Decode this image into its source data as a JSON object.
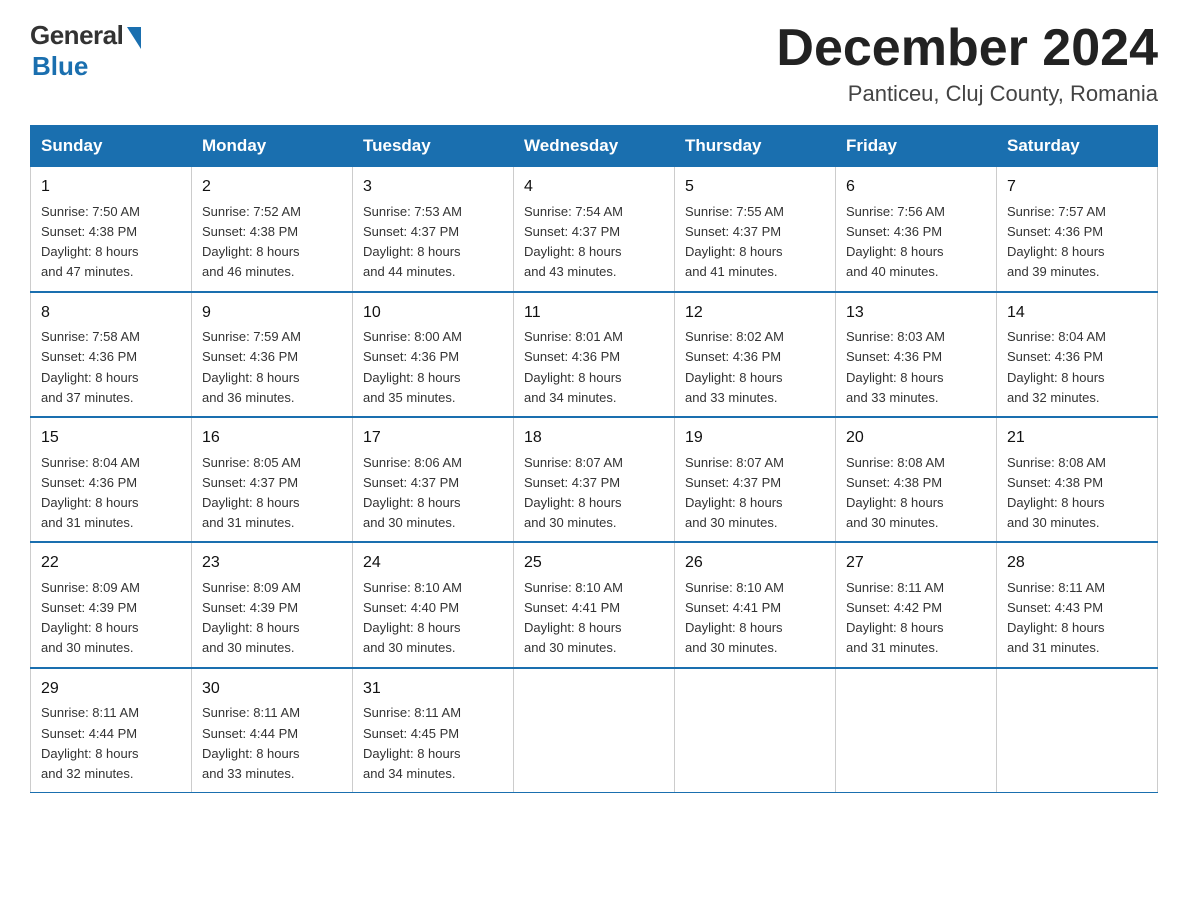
{
  "logo": {
    "general": "General",
    "blue": "Blue"
  },
  "title": "December 2024",
  "subtitle": "Panticeu, Cluj County, Romania",
  "weekdays": [
    "Sunday",
    "Monday",
    "Tuesday",
    "Wednesday",
    "Thursday",
    "Friday",
    "Saturday"
  ],
  "weeks": [
    [
      {
        "day": "1",
        "sunrise": "7:50 AM",
        "sunset": "4:38 PM",
        "daylight": "8 hours and 47 minutes."
      },
      {
        "day": "2",
        "sunrise": "7:52 AM",
        "sunset": "4:38 PM",
        "daylight": "8 hours and 46 minutes."
      },
      {
        "day": "3",
        "sunrise": "7:53 AM",
        "sunset": "4:37 PM",
        "daylight": "8 hours and 44 minutes."
      },
      {
        "day": "4",
        "sunrise": "7:54 AM",
        "sunset": "4:37 PM",
        "daylight": "8 hours and 43 minutes."
      },
      {
        "day": "5",
        "sunrise": "7:55 AM",
        "sunset": "4:37 PM",
        "daylight": "8 hours and 41 minutes."
      },
      {
        "day": "6",
        "sunrise": "7:56 AM",
        "sunset": "4:36 PM",
        "daylight": "8 hours and 40 minutes."
      },
      {
        "day": "7",
        "sunrise": "7:57 AM",
        "sunset": "4:36 PM",
        "daylight": "8 hours and 39 minutes."
      }
    ],
    [
      {
        "day": "8",
        "sunrise": "7:58 AM",
        "sunset": "4:36 PM",
        "daylight": "8 hours and 37 minutes."
      },
      {
        "day": "9",
        "sunrise": "7:59 AM",
        "sunset": "4:36 PM",
        "daylight": "8 hours and 36 minutes."
      },
      {
        "day": "10",
        "sunrise": "8:00 AM",
        "sunset": "4:36 PM",
        "daylight": "8 hours and 35 minutes."
      },
      {
        "day": "11",
        "sunrise": "8:01 AM",
        "sunset": "4:36 PM",
        "daylight": "8 hours and 34 minutes."
      },
      {
        "day": "12",
        "sunrise": "8:02 AM",
        "sunset": "4:36 PM",
        "daylight": "8 hours and 33 minutes."
      },
      {
        "day": "13",
        "sunrise": "8:03 AM",
        "sunset": "4:36 PM",
        "daylight": "8 hours and 33 minutes."
      },
      {
        "day": "14",
        "sunrise": "8:04 AM",
        "sunset": "4:36 PM",
        "daylight": "8 hours and 32 minutes."
      }
    ],
    [
      {
        "day": "15",
        "sunrise": "8:04 AM",
        "sunset": "4:36 PM",
        "daylight": "8 hours and 31 minutes."
      },
      {
        "day": "16",
        "sunrise": "8:05 AM",
        "sunset": "4:37 PM",
        "daylight": "8 hours and 31 minutes."
      },
      {
        "day": "17",
        "sunrise": "8:06 AM",
        "sunset": "4:37 PM",
        "daylight": "8 hours and 30 minutes."
      },
      {
        "day": "18",
        "sunrise": "8:07 AM",
        "sunset": "4:37 PM",
        "daylight": "8 hours and 30 minutes."
      },
      {
        "day": "19",
        "sunrise": "8:07 AM",
        "sunset": "4:37 PM",
        "daylight": "8 hours and 30 minutes."
      },
      {
        "day": "20",
        "sunrise": "8:08 AM",
        "sunset": "4:38 PM",
        "daylight": "8 hours and 30 minutes."
      },
      {
        "day": "21",
        "sunrise": "8:08 AM",
        "sunset": "4:38 PM",
        "daylight": "8 hours and 30 minutes."
      }
    ],
    [
      {
        "day": "22",
        "sunrise": "8:09 AM",
        "sunset": "4:39 PM",
        "daylight": "8 hours and 30 minutes."
      },
      {
        "day": "23",
        "sunrise": "8:09 AM",
        "sunset": "4:39 PM",
        "daylight": "8 hours and 30 minutes."
      },
      {
        "day": "24",
        "sunrise": "8:10 AM",
        "sunset": "4:40 PM",
        "daylight": "8 hours and 30 minutes."
      },
      {
        "day": "25",
        "sunrise": "8:10 AM",
        "sunset": "4:41 PM",
        "daylight": "8 hours and 30 minutes."
      },
      {
        "day": "26",
        "sunrise": "8:10 AM",
        "sunset": "4:41 PM",
        "daylight": "8 hours and 30 minutes."
      },
      {
        "day": "27",
        "sunrise": "8:11 AM",
        "sunset": "4:42 PM",
        "daylight": "8 hours and 31 minutes."
      },
      {
        "day": "28",
        "sunrise": "8:11 AM",
        "sunset": "4:43 PM",
        "daylight": "8 hours and 31 minutes."
      }
    ],
    [
      {
        "day": "29",
        "sunrise": "8:11 AM",
        "sunset": "4:44 PM",
        "daylight": "8 hours and 32 minutes."
      },
      {
        "day": "30",
        "sunrise": "8:11 AM",
        "sunset": "4:44 PM",
        "daylight": "8 hours and 33 minutes."
      },
      {
        "day": "31",
        "sunrise": "8:11 AM",
        "sunset": "4:45 PM",
        "daylight": "8 hours and 34 minutes."
      },
      null,
      null,
      null,
      null
    ]
  ],
  "labels": {
    "sunrise": "Sunrise:",
    "sunset": "Sunset:",
    "daylight": "Daylight:"
  }
}
